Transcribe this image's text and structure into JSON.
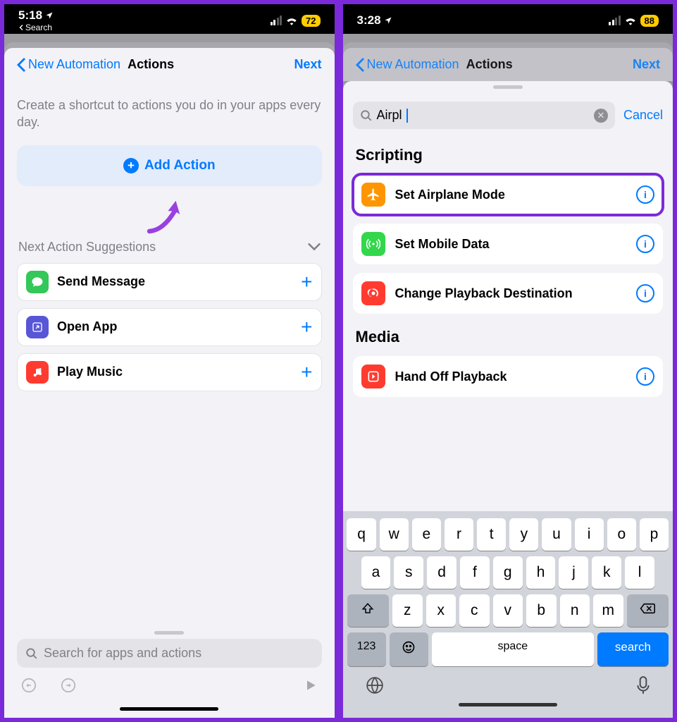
{
  "left": {
    "status": {
      "time": "5:18",
      "back_label": "Search",
      "battery": "72"
    },
    "nav": {
      "back": "New Automation",
      "title": "Actions",
      "next": "Next"
    },
    "help": "Create a shortcut to actions you do in your apps every day.",
    "add_action": "Add Action",
    "suggestions_header": "Next Action Suggestions",
    "suggestions": [
      {
        "label": "Send Message"
      },
      {
        "label": "Open App"
      },
      {
        "label": "Play Music"
      }
    ],
    "search_placeholder": "Search for apps and actions"
  },
  "right": {
    "status": {
      "time": "3:28",
      "battery": "88"
    },
    "nav": {
      "back": "New Automation",
      "title": "Actions",
      "next": "Next"
    },
    "search_value": "Airpl",
    "cancel": "Cancel",
    "sections": {
      "scripting": "Scripting",
      "media": "Media"
    },
    "results_scripting": [
      {
        "label": "Set Airplane Mode"
      },
      {
        "label": "Set Mobile Data"
      },
      {
        "label": "Change Playback Destination"
      }
    ],
    "results_media": [
      {
        "label": "Hand Off Playback"
      }
    ],
    "keyboard": {
      "rows": [
        [
          "q",
          "w",
          "e",
          "r",
          "t",
          "y",
          "u",
          "i",
          "o",
          "p"
        ],
        [
          "a",
          "s",
          "d",
          "f",
          "g",
          "h",
          "j",
          "k",
          "l"
        ],
        [
          "z",
          "x",
          "c",
          "v",
          "b",
          "n",
          "m"
        ]
      ],
      "num": "123",
      "space": "space",
      "search": "search"
    }
  }
}
